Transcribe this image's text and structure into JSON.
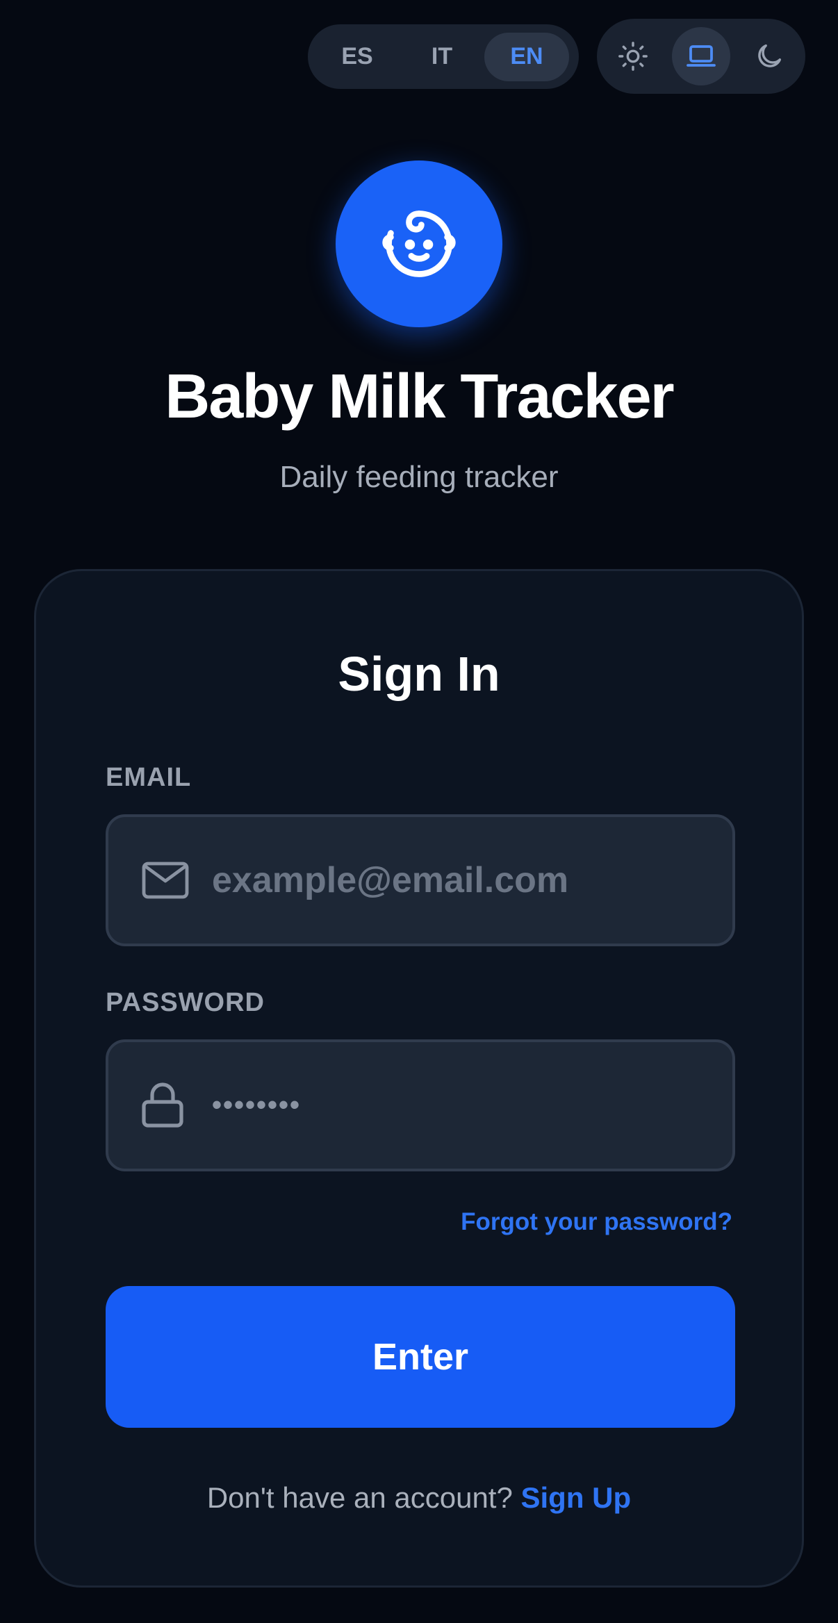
{
  "header": {
    "languages": [
      "ES",
      "IT",
      "EN"
    ],
    "active_language": "EN",
    "theme_modes": [
      {
        "icon": "sun-icon",
        "active": false
      },
      {
        "icon": "laptop-icon",
        "active": true
      },
      {
        "icon": "moon-icon",
        "active": false
      }
    ]
  },
  "brand": {
    "logo_icon": "baby-face-icon",
    "title": "Baby Milk Tracker",
    "subtitle": "Daily feeding tracker"
  },
  "login": {
    "title": "Sign In",
    "email_label": "EMAIL",
    "email_placeholder": "example@email.com",
    "password_label": "PASSWORD",
    "password_placeholder": "••••••••",
    "forgot_link": "Forgot your password?",
    "submit_label": "Enter",
    "signup_prompt": "Don't have an account?",
    "signup_link": "Sign Up"
  },
  "colors": {
    "background": "#050912",
    "card": "#0c1421",
    "accent": "#175cf5",
    "link": "#2f74f3"
  }
}
